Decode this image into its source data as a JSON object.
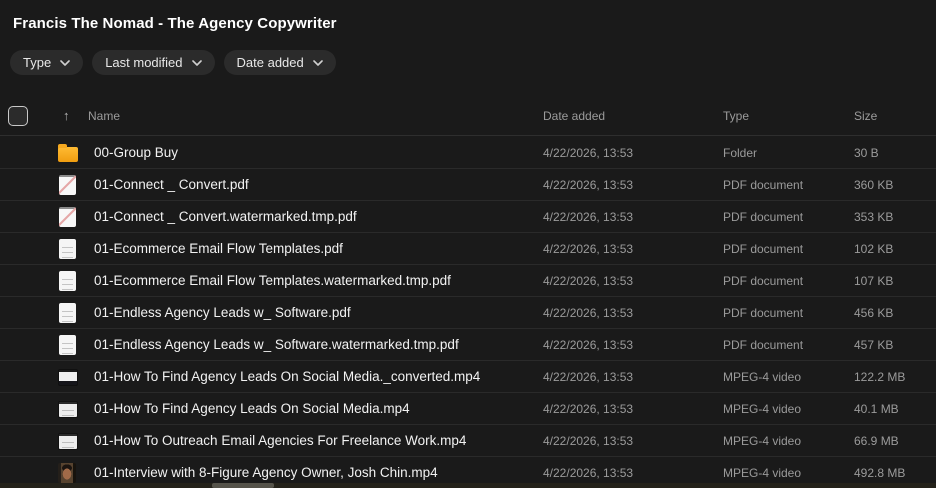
{
  "page": {
    "title": "Francis The Nomad - The Agency Copywriter"
  },
  "filters": [
    {
      "label": "Type"
    },
    {
      "label": "Last modified"
    },
    {
      "label": "Date added"
    }
  ],
  "table": {
    "sort_arrow": "↑",
    "headers": {
      "name": "Name",
      "date_added": "Date added",
      "type": "Type",
      "size": "Size"
    },
    "rows": [
      {
        "name": "00-Group Buy",
        "date_added": "4/22/2026, 13:53",
        "type": "Folder",
        "size": "30 B",
        "icon": "folder"
      },
      {
        "name": "01-Connect _ Convert.pdf",
        "date_added": "4/22/2026, 13:53",
        "type": "PDF document",
        "size": "360 KB",
        "icon": "pdf-ribbon"
      },
      {
        "name": "01-Connect _ Convert.watermarked.tmp.pdf",
        "date_added": "4/22/2026, 13:53",
        "type": "PDF document",
        "size": "353 KB",
        "icon": "pdf-ribbon"
      },
      {
        "name": "01-Ecommerce Email Flow Templates.pdf",
        "date_added": "4/22/2026, 13:53",
        "type": "PDF document",
        "size": "102 KB",
        "icon": "pdf"
      },
      {
        "name": "01-Ecommerce Email Flow Templates.watermarked.tmp.pdf",
        "date_added": "4/22/2026, 13:53",
        "type": "PDF document",
        "size": "107 KB",
        "icon": "pdf"
      },
      {
        "name": "01-Endless Agency Leads w_ Software.pdf",
        "date_added": "4/22/2026, 13:53",
        "type": "PDF document",
        "size": "456 KB",
        "icon": "pdf"
      },
      {
        "name": "01-Endless Agency Leads w_ Software.watermarked.tmp.pdf",
        "date_added": "4/22/2026, 13:53",
        "type": "PDF document",
        "size": "457 KB",
        "icon": "pdf"
      },
      {
        "name": "01-How To Find Agency Leads On Social Media._converted.mp4",
        "date_added": "4/22/2026, 13:53",
        "type": "MPEG-4 video",
        "size": "122.2 MB",
        "icon": "video-dark"
      },
      {
        "name": "01-How To Find Agency Leads On Social Media.mp4",
        "date_added": "4/22/2026, 13:53",
        "type": "MPEG-4 video",
        "size": "40.1 MB",
        "icon": "video-light"
      },
      {
        "name": "01-How To Outreach Email Agencies For Freelance Work.mp4",
        "date_added": "4/22/2026, 13:53",
        "type": "MPEG-4 video",
        "size": "66.9 MB",
        "icon": "video-light"
      },
      {
        "name": "01-Interview with 8-Figure Agency Owner, Josh Chin.mp4",
        "date_added": "4/22/2026, 13:53",
        "type": "MPEG-4 video",
        "size": "492.8 MB",
        "icon": "portrait"
      }
    ]
  },
  "colors": {
    "background": "#1a1a1a",
    "chip_background": "#2b2b2b",
    "row_separator": "#2a2a2a",
    "primary_text": "#f2f2f2",
    "secondary_text": "#9b9b9b",
    "folder_icon": "#f5a81f"
  }
}
